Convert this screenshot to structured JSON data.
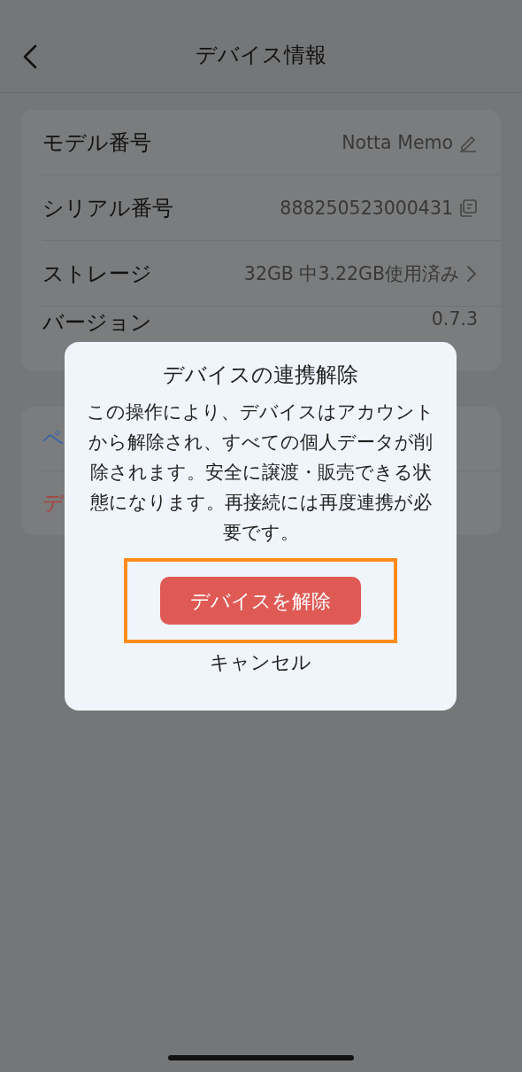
{
  "header": {
    "title": "デバイス情報"
  },
  "info_rows": [
    {
      "label": "モデル番号",
      "value": "Notta Memo",
      "kind": "edit"
    },
    {
      "label": "シリアル番号",
      "value": "888250523000431",
      "kind": "copy"
    },
    {
      "label": "ストレージ",
      "value": "32GB 中3.22GB使用済み",
      "kind": "link"
    },
    {
      "label": "バージョン",
      "value": "0.7.3",
      "kind": "plain"
    }
  ],
  "actions": [
    {
      "label": "ペ",
      "color": "#3563ad"
    },
    {
      "label": "デ",
      "color": "#a8443f"
    }
  ],
  "dialog": {
    "title": "デバイスの連携解除",
    "message": "この操作により、デバイスはアカウントから解除され、すべての個人データが削除されます。安全に譲渡・販売できる状態になります。再接続には再度連携が必要です。",
    "confirm": "デバイスを解除",
    "confirm_highlighted": true,
    "cancel": "キャンセル"
  }
}
